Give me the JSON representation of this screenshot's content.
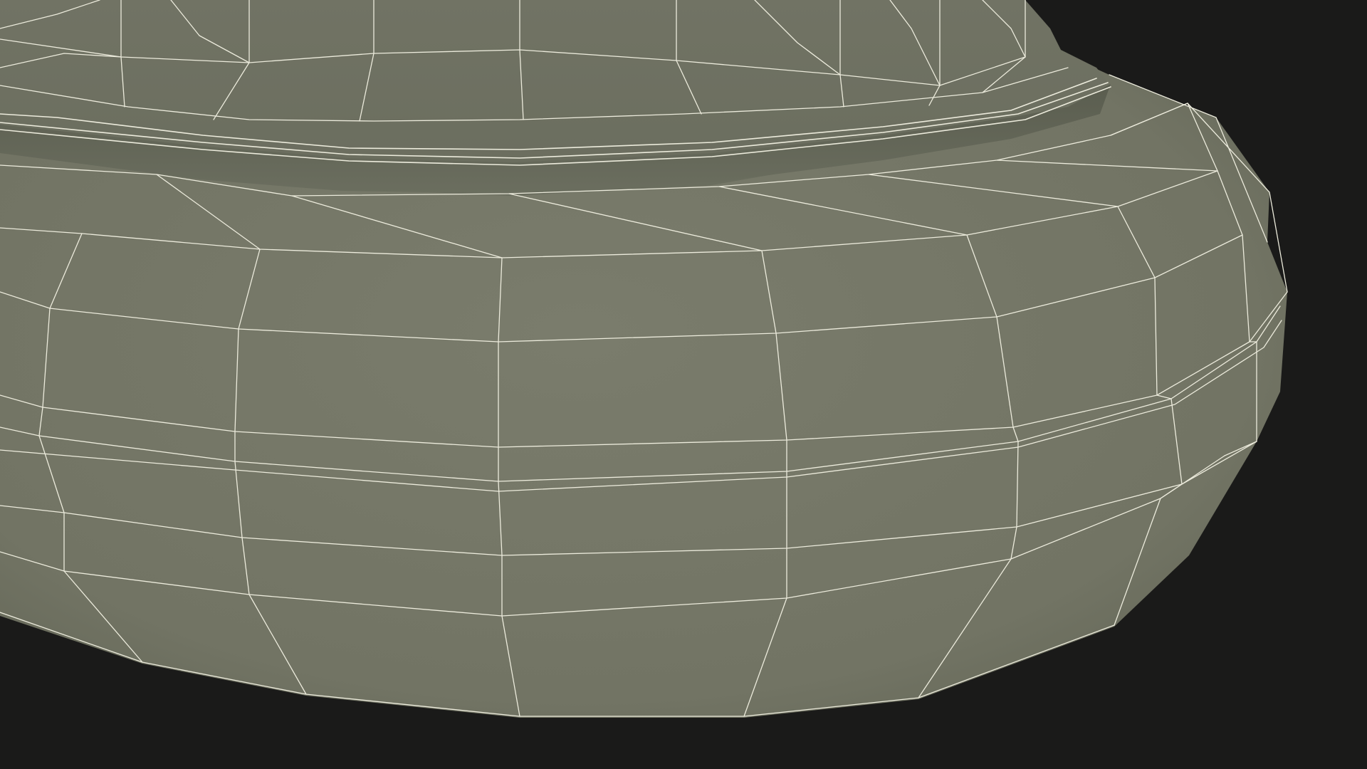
{
  "scene": {
    "subject": "wireframe-mesh",
    "colors": {
      "background": "#1a1a19",
      "body_light": "#7a7c6c",
      "body_mid": "#727464",
      "body_dark": "#5e6152",
      "groove_dark": "#4e5144",
      "wire": "#ecebdc"
    }
  }
}
